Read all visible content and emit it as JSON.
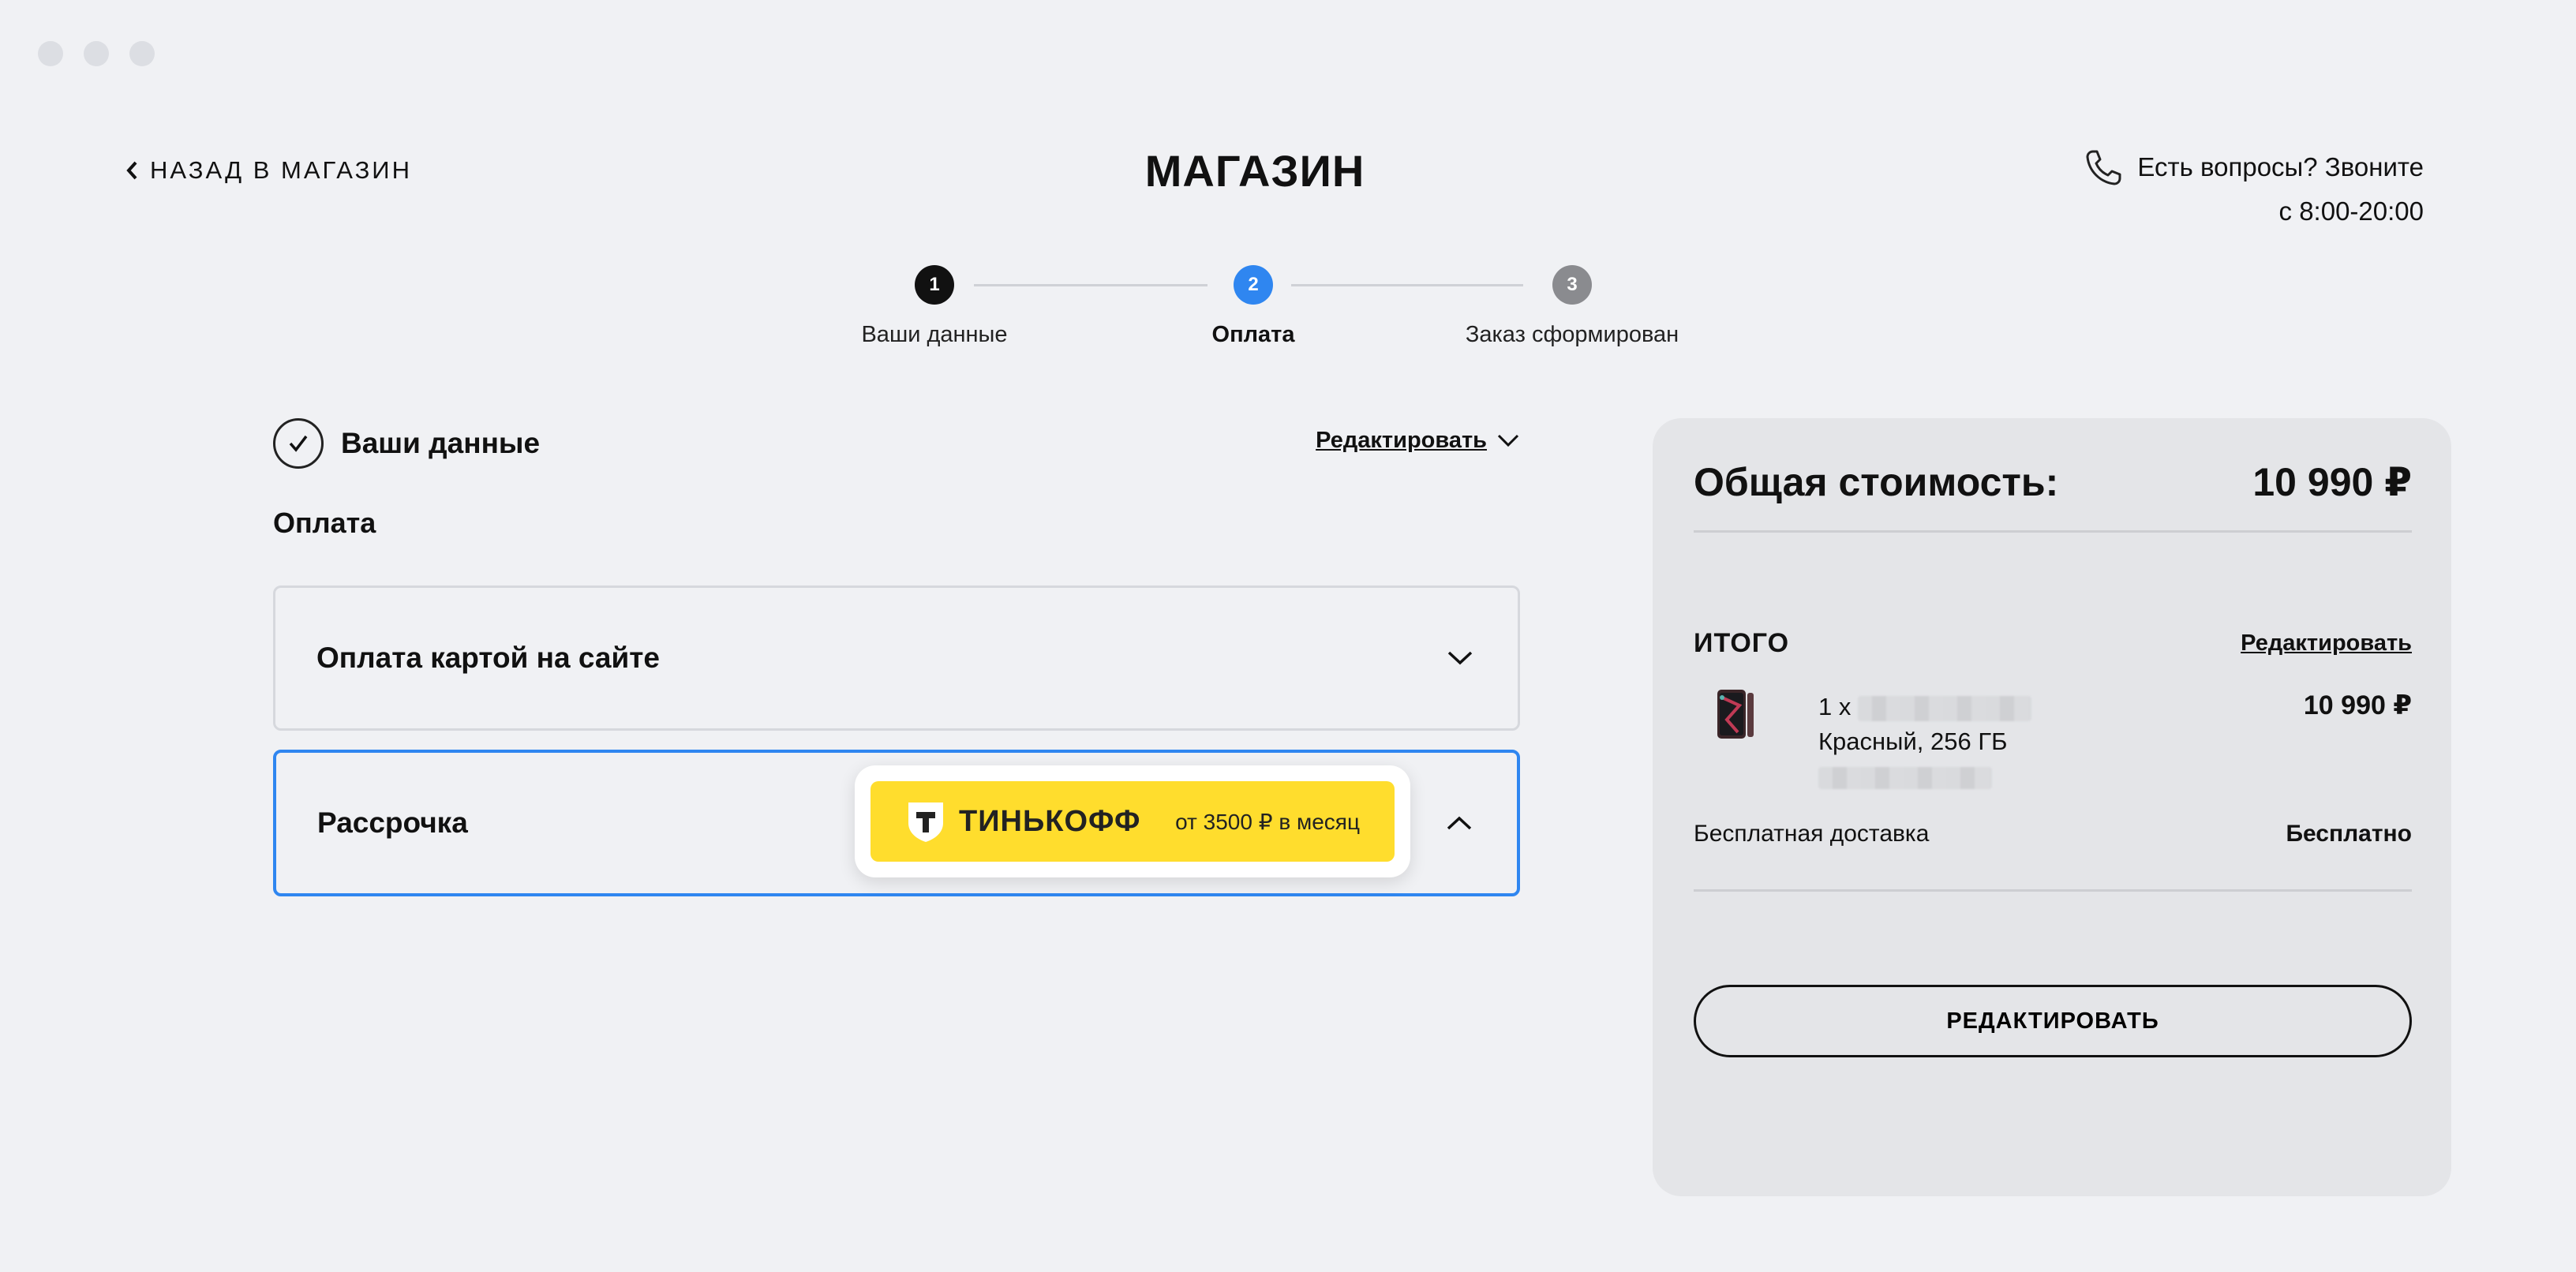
{
  "header": {
    "back_label": "НАЗАД В МАГАЗИН",
    "brand": "МАГАЗИН",
    "contact_line1": "Есть вопросы? Звоните",
    "contact_line2": "с 8:00-20:00"
  },
  "stepper": {
    "steps": [
      {
        "number": "1",
        "label": "Ваши данные",
        "state": "done"
      },
      {
        "number": "2",
        "label": "Оплата",
        "state": "active"
      },
      {
        "number": "3",
        "label": "Заказ сформирован",
        "state": "pending"
      }
    ]
  },
  "your_data": {
    "title": "Ваши данные",
    "edit_label": "Редактировать"
  },
  "payment": {
    "heading": "Оплата",
    "options": [
      {
        "label": "Оплата картой на сайте",
        "expanded": false
      },
      {
        "label": "Рассрочка",
        "expanded": true,
        "selected": true
      }
    ],
    "tinkoff": {
      "name": "ТИНЬКОФФ",
      "offer": "от 3500 ₽ в месяц"
    }
  },
  "summary": {
    "total_label": "Общая стоимость:",
    "total_value": "10 990 ₽",
    "itogo_label": "ИТОГО",
    "itogo_edit": "Редактировать",
    "item": {
      "qty_prefix": "1 x",
      "variant": "Красный, 256 ГБ",
      "price": "10 990 ₽"
    },
    "delivery_label": "Бесплатная доставка",
    "delivery_value": "Бесплатно",
    "edit_button": "РЕДАКТИРОВАТЬ"
  },
  "colors": {
    "accent_blue": "#2f86f0",
    "tinkoff_yellow": "#ffdd2d",
    "step_done": "#111111",
    "step_pending": "#8a8b8f",
    "background": "#f0f1f4",
    "panel": "#e4e5e8"
  }
}
